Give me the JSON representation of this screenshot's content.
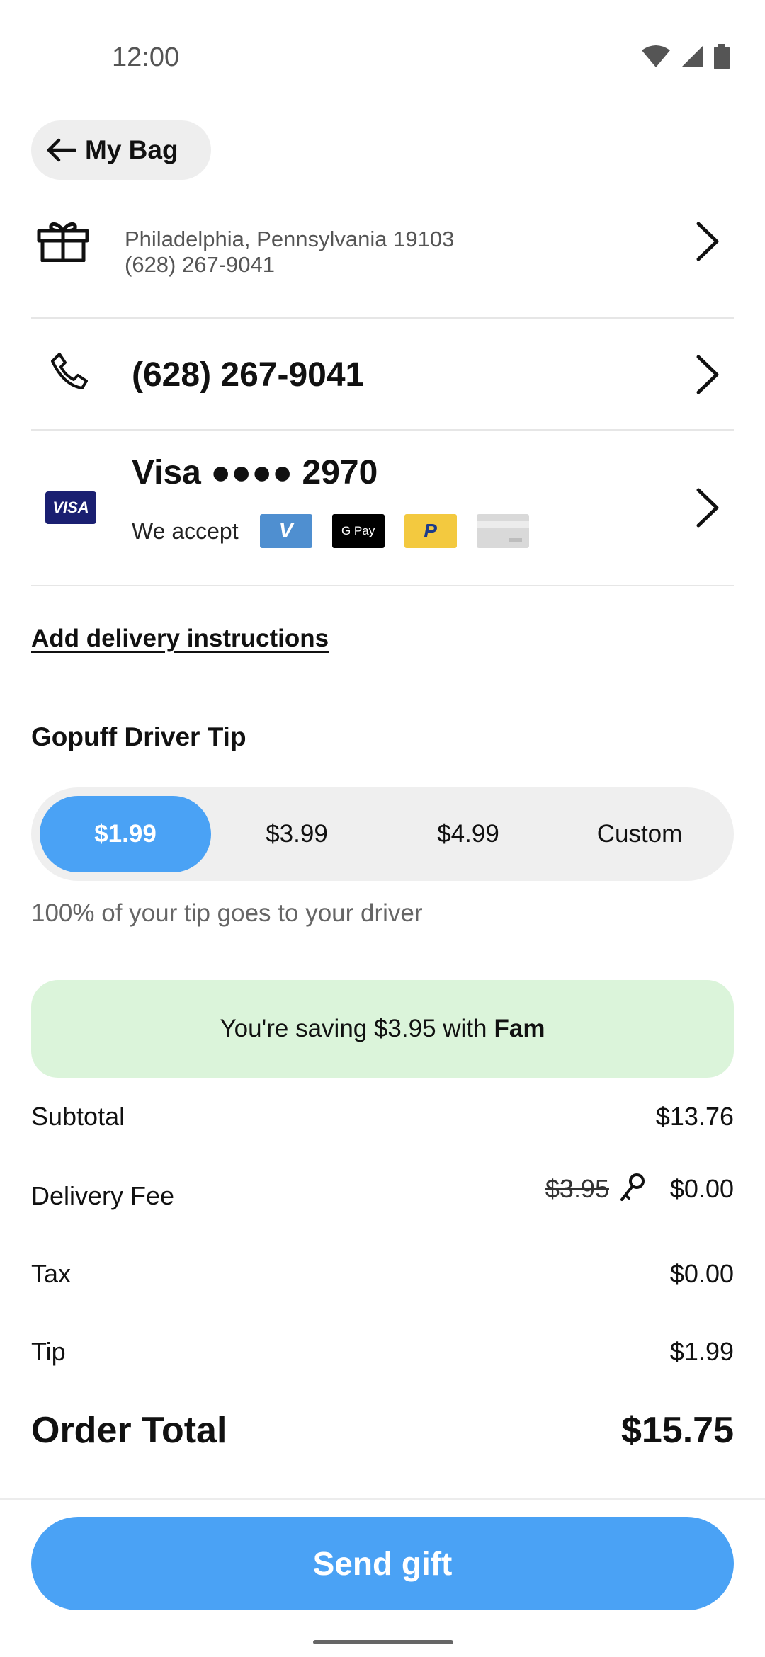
{
  "status_bar": {
    "time": "12:00"
  },
  "header": {
    "back_label": "My Bag"
  },
  "address": {
    "line1": "Philadelphia, Pennsylvania 19103",
    "line2": "(628) 267-9041"
  },
  "phone": {
    "number": "(628) 267-9041"
  },
  "payment": {
    "badge": "VISA",
    "title": "Visa ●●●● 2970",
    "accept_label": "We accept",
    "methods": [
      "venmo",
      "google-pay",
      "paypal",
      "card"
    ],
    "venmo_glyph": "V",
    "gpay_text": "G Pay",
    "paypal_glyph": "P"
  },
  "delivery": {
    "instructions_link": "Add delivery instructions"
  },
  "tip": {
    "title": "Gopuff Driver Tip",
    "options": [
      "$1.99",
      "$3.99",
      "$4.99",
      "Custom"
    ],
    "selected_index": 0,
    "note": "100% of your tip goes to your driver"
  },
  "savings": {
    "text": "You're saving $3.95 with",
    "brand": "Fam"
  },
  "summary": {
    "subtotal_label": "Subtotal",
    "subtotal_value": "$13.76",
    "delivery_label": "Delivery Fee",
    "delivery_original": "$3.95",
    "delivery_value": "$0.00",
    "tax_label": "Tax",
    "tax_value": "$0.00",
    "tip_label": "Tip",
    "tip_value": "$1.99",
    "total_label": "Order Total",
    "total_value": "$15.75"
  },
  "cta": {
    "label": "Send gift"
  },
  "colors": {
    "accent": "#4aa2f5",
    "savings_bg": "#dbf4da",
    "visa_blue": "#1a1f71"
  }
}
